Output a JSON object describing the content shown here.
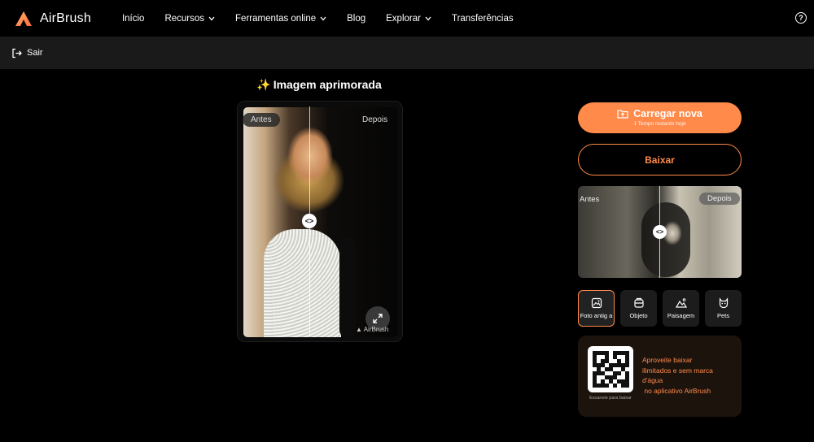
{
  "header": {
    "brand": "AirBrush",
    "menu": [
      {
        "label": "Início",
        "dropdown": false
      },
      {
        "label": "Recursos",
        "dropdown": true
      },
      {
        "label": "Ferramentas online",
        "dropdown": true
      },
      {
        "label": "Blog",
        "dropdown": false
      },
      {
        "label": "Explorar",
        "dropdown": true
      },
      {
        "label": "Transferências",
        "dropdown": false
      }
    ],
    "help": "?"
  },
  "subbar": {
    "exit_label": "Sair"
  },
  "main": {
    "title": "Imagem aprimorada",
    "before": "Antes",
    "after": "Depois",
    "watermark": "AirBrush"
  },
  "side": {
    "upload_label": "Carregar nova",
    "upload_sub": "1 Tempo restante hoje",
    "download_label": "Baixar",
    "sample_before": "Antes",
    "sample_after": "Depois",
    "categories": [
      {
        "label": "Foto antig a",
        "icon": "old-photo-icon",
        "active": true
      },
      {
        "label": "Objeto",
        "icon": "object-icon",
        "active": false
      },
      {
        "label": "Paisagem",
        "icon": "landscape-icon",
        "active": false
      },
      {
        "label": "Pets",
        "icon": "pet-icon",
        "active": false
      }
    ],
    "promo_caption": "Escaneie para baixar",
    "promo_line1": "Aproveite baixar",
    "promo_line2": "ilimitados e sem marca",
    "promo_line3": "d'água",
    "promo_line4": " no aplicativo AirBrush"
  },
  "colors": {
    "accent": "#ff8a4a",
    "background": "#000000",
    "bar": "#1a1a1a"
  }
}
